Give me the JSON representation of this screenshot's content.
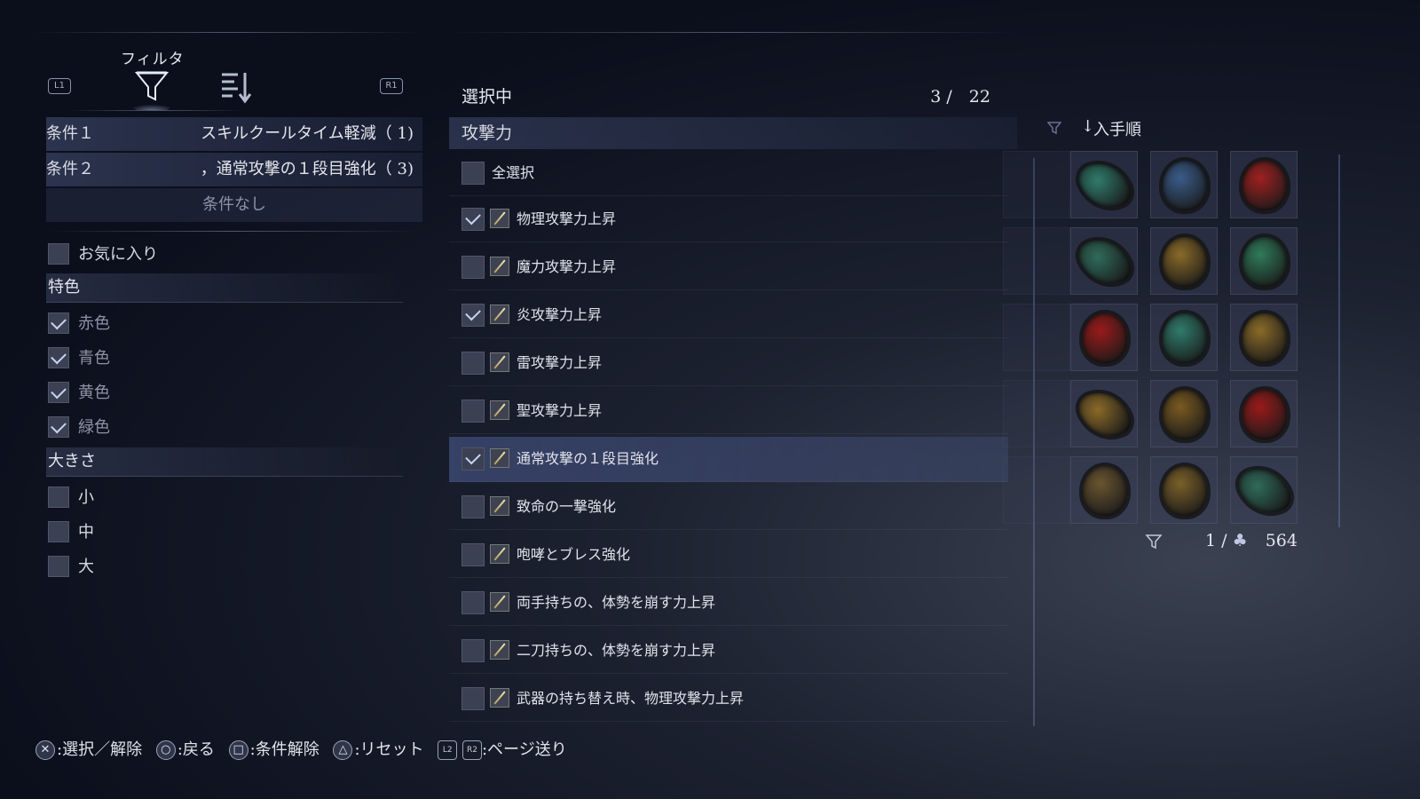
{
  "filter_panel": {
    "tab_label": "フィルタ",
    "l_button": "L1",
    "r_button": "R1",
    "conditions": [
      {
        "label": "条件１",
        "value": "スキルクールタイム軽減（ 1)"
      },
      {
        "label": "条件２",
        "value": "，通常攻撃の１段目強化（ 3)"
      }
    ],
    "no_condition": "条件なし",
    "favorite_label": "お気に入り",
    "color_section": "特色",
    "colors": [
      {
        "label": "赤色",
        "checked": true
      },
      {
        "label": "青色",
        "checked": true
      },
      {
        "label": "黄色",
        "checked": true
      },
      {
        "label": "緑色",
        "checked": true
      }
    ],
    "size_section": "大きさ",
    "sizes": [
      {
        "label": "小",
        "checked": false
      },
      {
        "label": "中",
        "checked": false
      },
      {
        "label": "大",
        "checked": false
      }
    ]
  },
  "list_panel": {
    "selected_label": "選択中",
    "selected_count": "3 /　22",
    "category": "攻撃力",
    "select_all": "全選択",
    "items": [
      {
        "label": "物理攻撃力上昇",
        "checked": true,
        "highlight": false
      },
      {
        "label": "魔力攻撃力上昇",
        "checked": false,
        "highlight": false
      },
      {
        "label": "炎攻撃力上昇",
        "checked": true,
        "highlight": false
      },
      {
        "label": "雷攻撃力上昇",
        "checked": false,
        "highlight": false
      },
      {
        "label": "聖攻撃力上昇",
        "checked": false,
        "highlight": false
      },
      {
        "label": "通常攻撃の１段目強化",
        "checked": true,
        "highlight": true
      },
      {
        "label": "致命の一撃強化",
        "checked": false,
        "highlight": false
      },
      {
        "label": "咆哮とブレス強化",
        "checked": false,
        "highlight": false
      },
      {
        "label": "両手持ちの、体勢を崩す力上昇",
        "checked": false,
        "highlight": false
      },
      {
        "label": "二刀持ちの、体勢を崩す力上昇",
        "checked": false,
        "highlight": false
      },
      {
        "label": "武器の持ち替え時、物理攻撃力上昇",
        "checked": false,
        "highlight": false
      }
    ]
  },
  "grid_panel": {
    "sort_label": "入手順",
    "page": "1 /",
    "total": "564",
    "gems": [
      {
        "color": "#2f7b6a",
        "shape": "shard"
      },
      {
        "color": "#3a5c8a",
        "shape": "round"
      },
      {
        "color": "#a02020",
        "shape": "round"
      },
      {
        "color": "#2f6b5a",
        "shape": "shard"
      },
      {
        "color": "#8a6a28",
        "shape": "round"
      },
      {
        "color": "#2f7b5a",
        "shape": "round"
      },
      {
        "color": "#9a1a1a",
        "shape": "round"
      },
      {
        "color": "#2f7b6a",
        "shape": "round"
      },
      {
        "color": "#8a6a28",
        "shape": "round"
      },
      {
        "color": "#8a6a28",
        "shape": "shard"
      },
      {
        "color": "#7a5a20",
        "shape": "round"
      },
      {
        "color": "#9a1a1a",
        "shape": "round"
      },
      {
        "color": "#6a5530",
        "shape": "round"
      },
      {
        "color": "#7a6028",
        "shape": "round"
      },
      {
        "color": "#2f6b5a",
        "shape": "shard"
      }
    ]
  },
  "help_bar": {
    "select": ":選択／解除",
    "back": ":戻る",
    "clear": ":条件解除",
    "reset": ":リセット",
    "page": ":ページ送り",
    "l2": "L2",
    "r2": "R2"
  }
}
